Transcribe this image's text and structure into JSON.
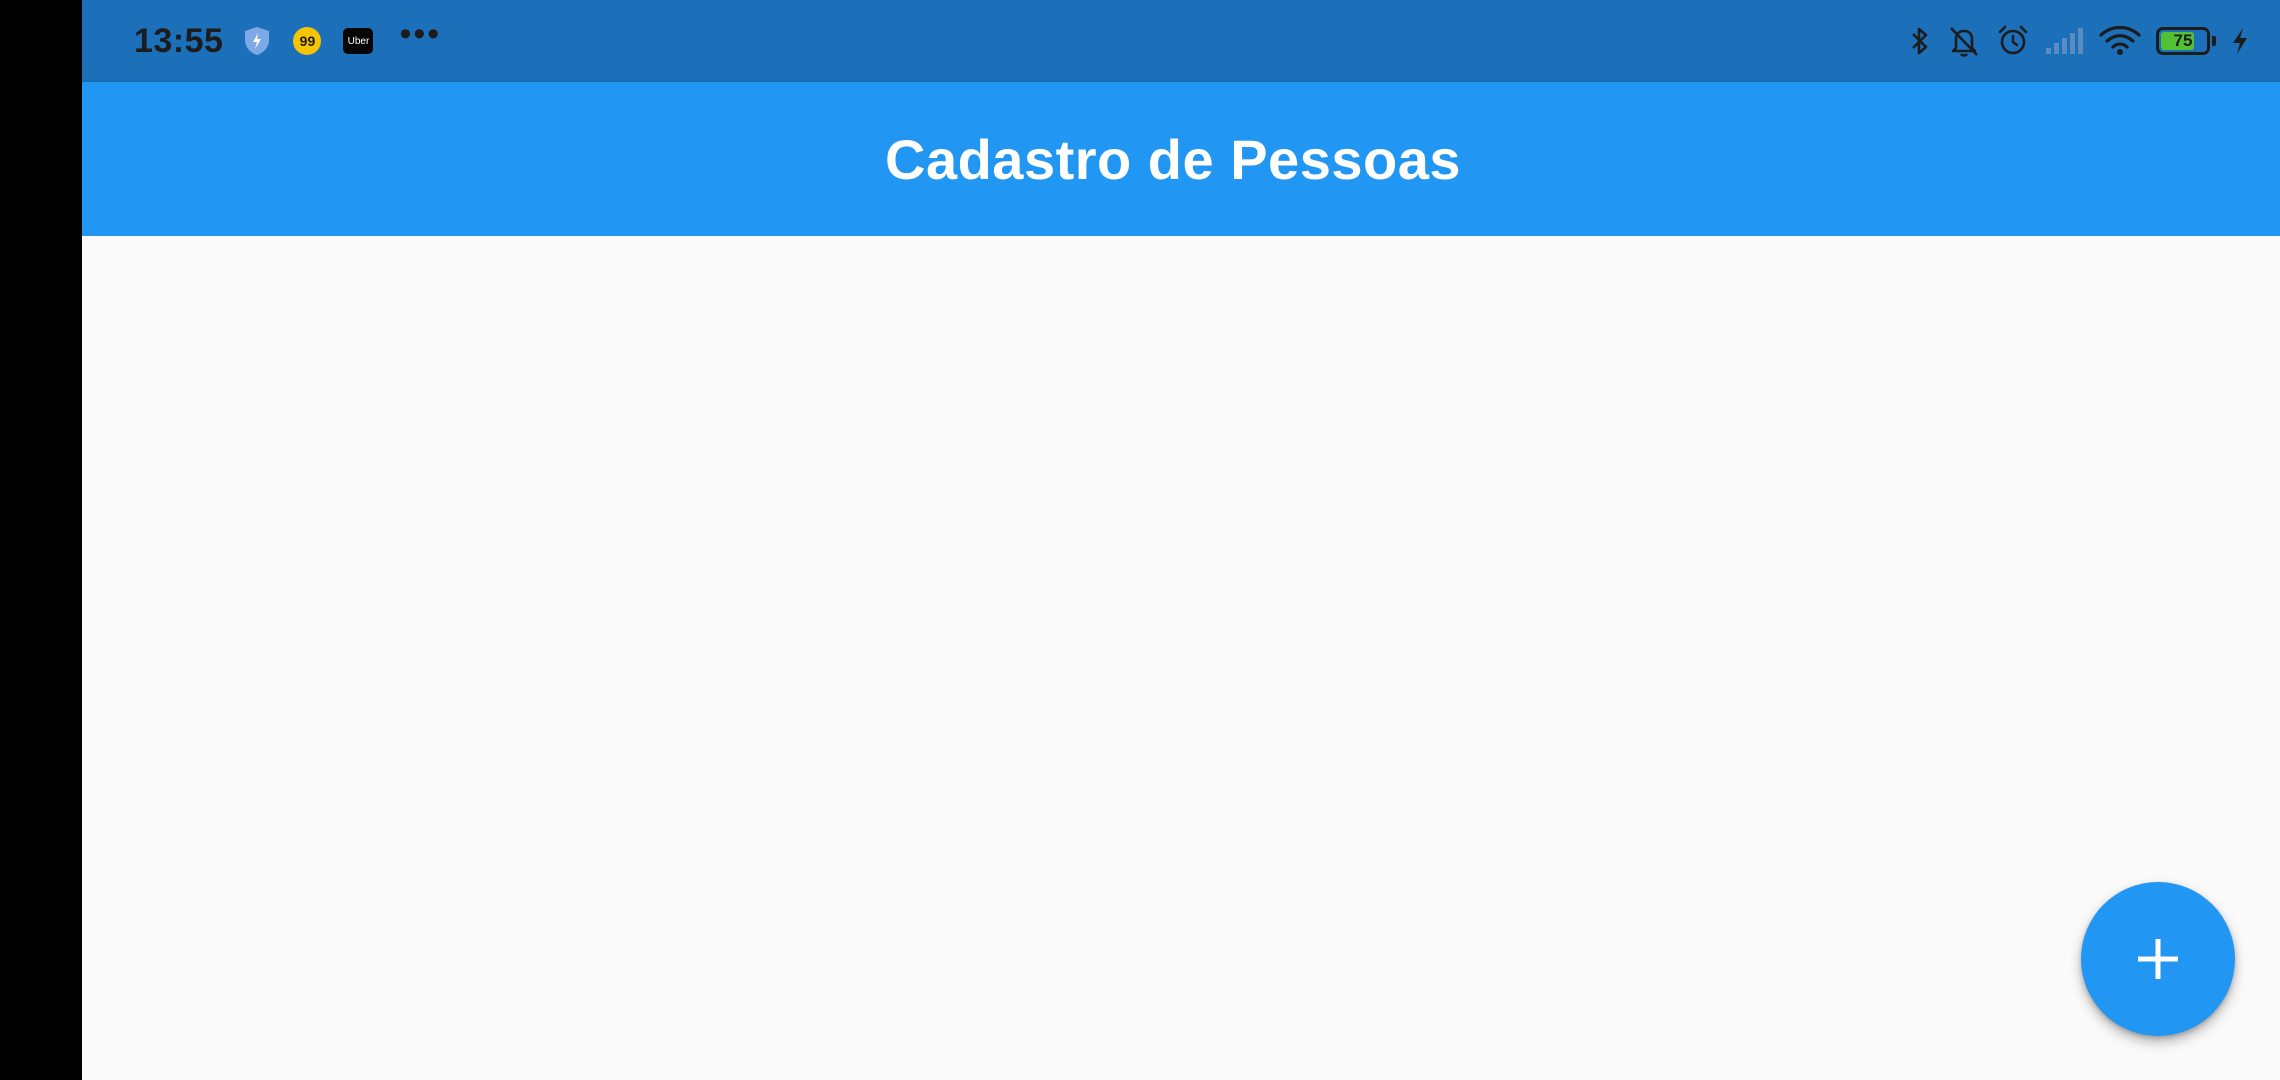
{
  "status_bar": {
    "time": "13:55",
    "app_99_label": "99",
    "uber_label": "Uber",
    "more_label": "•••",
    "battery_level": "75",
    "battery_fraction": 0.75,
    "icons": [
      "bluetooth-icon",
      "notifications-muted-icon",
      "alarm-icon",
      "signal-icon",
      "wifi-icon",
      "battery-icon",
      "charging-icon"
    ]
  },
  "app_bar": {
    "title": "Cadastro de Pessoas"
  },
  "fab": {
    "icon": "plus-icon"
  },
  "colors": {
    "status_bar": "#1b70b9",
    "primary": "#2196f3",
    "background": "#fafafa",
    "battery_fill": "#52c234"
  }
}
